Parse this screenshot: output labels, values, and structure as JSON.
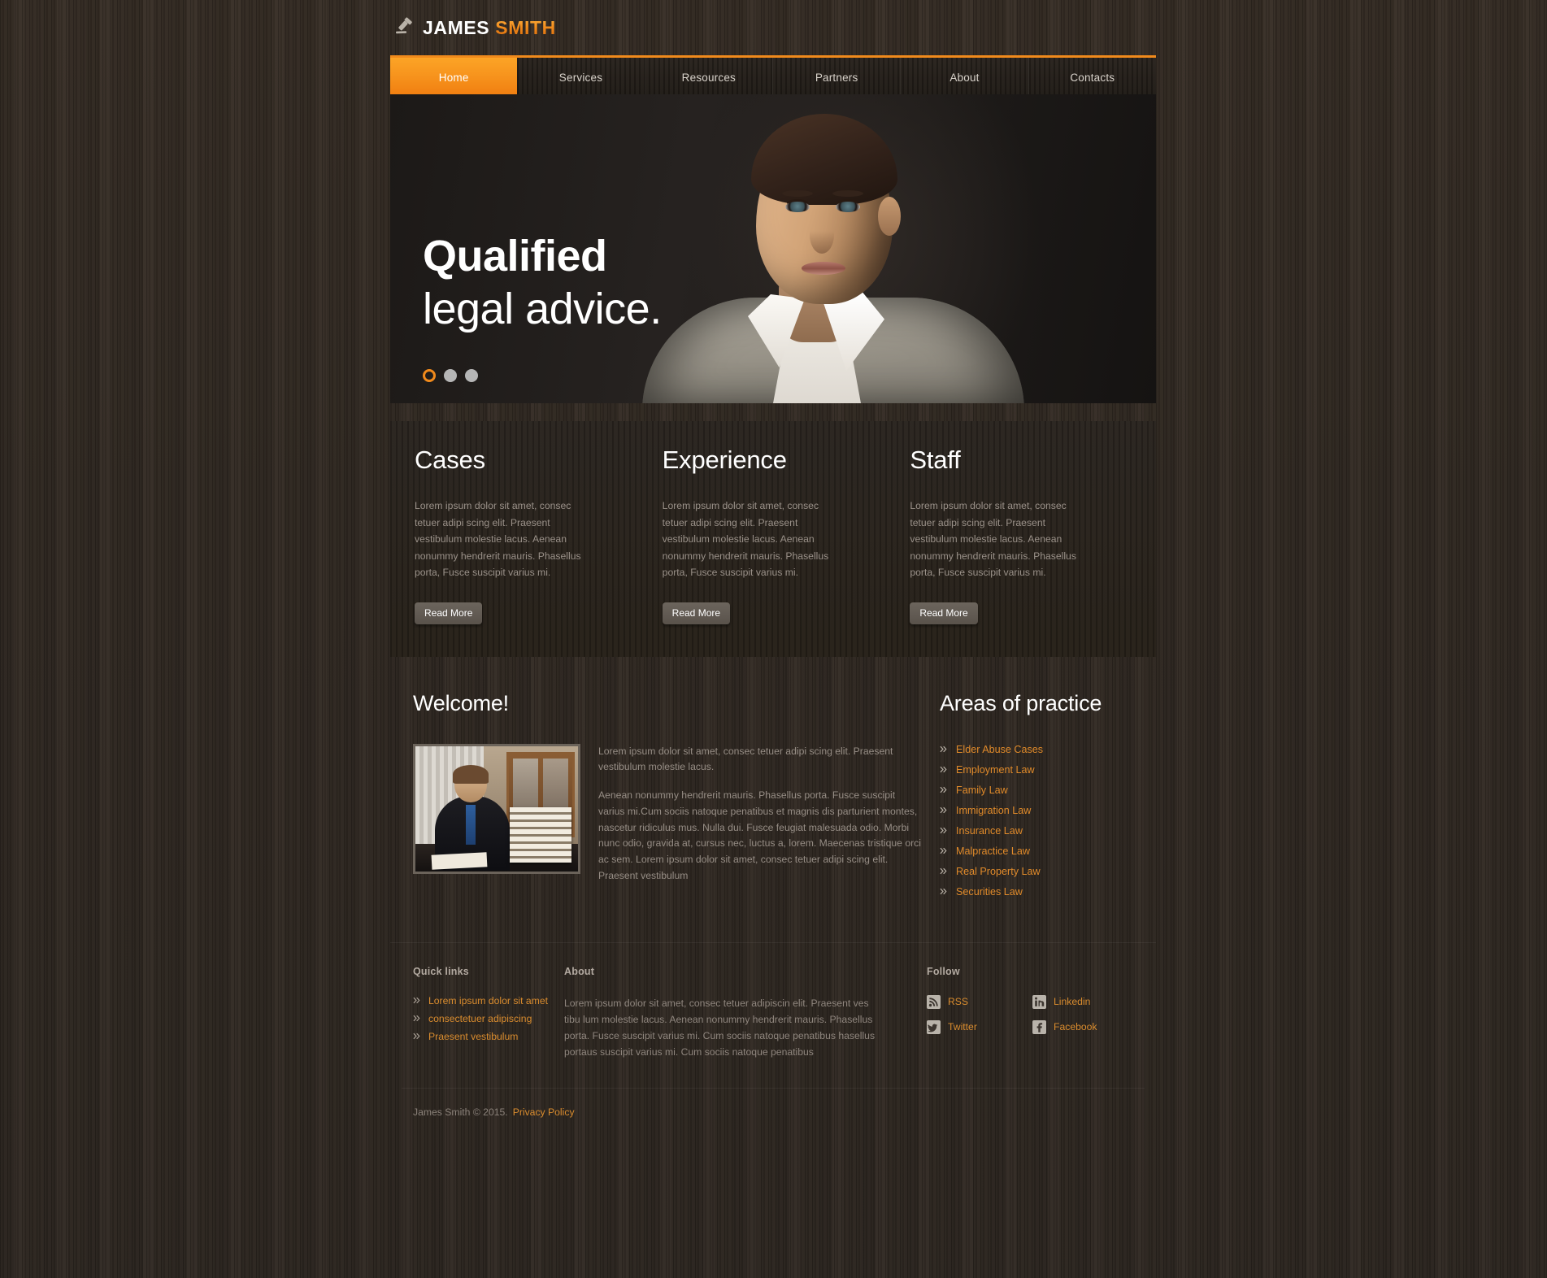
{
  "brand": {
    "icon": "gavel-icon",
    "first_name": "JAMES",
    "last_name": "SMITH"
  },
  "nav": {
    "items": [
      {
        "label": "Home",
        "active": true
      },
      {
        "label": "Services",
        "active": false
      },
      {
        "label": "Resources",
        "active": false
      },
      {
        "label": "Partners",
        "active": false
      },
      {
        "label": "About",
        "active": false
      },
      {
        "label": "Contacts",
        "active": false
      }
    ]
  },
  "hero": {
    "title_line1": "Qualified",
    "title_line2": "legal advice.",
    "slides_total": 3,
    "active_slide": 1
  },
  "features": [
    {
      "title": "Cases",
      "text": "Lorem ipsum dolor sit amet, consec tetuer adipi scing elit. Praesent vestibulum molestie lacus. Aenean nonummy hendrerit mauris. Phasellus porta, Fusce suscipit varius mi.",
      "button": "Read More"
    },
    {
      "title": "Experience",
      "text": "Lorem ipsum dolor sit amet, consec tetuer adipi scing elit. Praesent vestibulum molestie lacus. Aenean nonummy hendrerit mauris. Phasellus porta, Fusce suscipit varius mi.",
      "button": "Read More"
    },
    {
      "title": "Staff",
      "text": "Lorem ipsum dolor sit amet, consec tetuer adipi scing elit. Praesent vestibulum molestie lacus. Aenean nonummy hendrerit mauris. Phasellus porta, Fusce suscipit varius mi.",
      "button": "Read More"
    }
  ],
  "welcome": {
    "title": "Welcome!",
    "image_alt": "lawyer-at-desk-photo",
    "paragraph1": "Lorem ipsum dolor sit amet, consec tetuer adipi scing elit. Praesent vestibulum molestie lacus.",
    "paragraph2": "Aenean nonummy hendrerit mauris. Phasellus porta. Fusce suscipit varius mi.Cum sociis natoque penatibus et magnis dis parturient montes, nascetur ridiculus mus. Nulla dui. Fusce feugiat malesuada odio. Morbi nunc odio, gravida at, cursus nec, luctus a, lorem. Maecenas tristique orci ac sem. Lorem ipsum dolor sit amet, consec tetuer adipi scing elit. Praesent vestibulum"
  },
  "practice": {
    "title": "Areas of practice",
    "items": [
      "Elder Abuse Cases",
      "Employment Law",
      "Family Law",
      "Immigration Law",
      "Insurance Law",
      "Malpractice Law",
      "Real Property Law",
      "Securities Law"
    ]
  },
  "footer": {
    "quick_links_title": "Quick links",
    "quick_links": [
      "Lorem ipsum dolor sit amet",
      "consectetuer adipiscing",
      "Praesent vestibulum"
    ],
    "about_title": "About",
    "about_text": "Lorem ipsum dolor sit amet, consec tetuer adipiscin elit. Praesent ves tibu lum molestie lacus. Aenean nonummy hendrerit mauris. Phasellus porta. Fusce suscipit varius mi. Cum sociis natoque penatibus hasellus portaus suscipit varius mi. Cum sociis natoque penatibus",
    "follow_title": "Follow",
    "social": [
      {
        "label": "RSS",
        "icon": "rss-icon"
      },
      {
        "label": "Linkedin",
        "icon": "linkedin-icon"
      },
      {
        "label": "Twitter",
        "icon": "twitter-icon"
      },
      {
        "label": "Facebook",
        "icon": "facebook-icon"
      }
    ],
    "copyright": "James Smith  © 2015.",
    "privacy_label": "Privacy Policy"
  },
  "colors": {
    "accent": "#f08a1c",
    "link": "#d98c2e",
    "page_bg": "#322a22",
    "panel_bg": "#2b2520",
    "text": "#968d85"
  }
}
